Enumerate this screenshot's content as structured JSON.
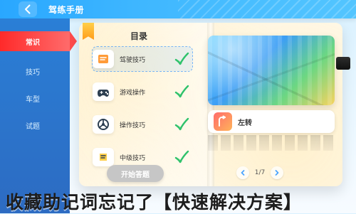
{
  "header": {
    "title": "驾练手册",
    "back_icon": "back-arrow-icon"
  },
  "sidebar": {
    "items": [
      {
        "label": "常识",
        "active": true
      },
      {
        "label": "技巧"
      },
      {
        "label": "车型"
      },
      {
        "label": "试题"
      }
    ]
  },
  "toc": {
    "title": "目录",
    "items": [
      {
        "label": "驾驶技巧",
        "icon": "driving-tips-icon",
        "checked": true,
        "active": true
      },
      {
        "label": "游戏操作",
        "icon": "gamepad-icon",
        "checked": true
      },
      {
        "label": "操作技巧",
        "icon": "steering-wheel-icon",
        "checked": true
      },
      {
        "label": "中级技巧",
        "icon": "tools-icon",
        "checked": true
      }
    ]
  },
  "preview": {
    "tip_title": "左转",
    "tip_icon": "left-turn-icon"
  },
  "actions": {
    "start_label": "开始答题"
  },
  "pager": {
    "text": "1/7"
  },
  "headline": {
    "text": "收藏助记词忘记了【快速解决方案】"
  },
  "colors": {
    "accent": "#ff3b3b",
    "sidebar": "#2d6bc2",
    "topbar": "#3fb7ff",
    "check": "#2ec26b"
  }
}
